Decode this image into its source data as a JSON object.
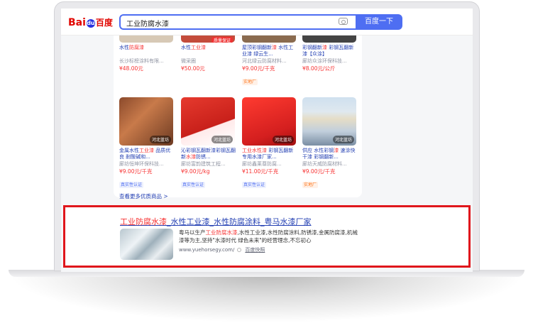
{
  "search": {
    "logo_text_1": "Bai",
    "logo_paw": "du",
    "logo_text_2": "百度",
    "query": "工业防腐水漆",
    "button_label": "百度一下"
  },
  "products": {
    "top_row": [
      {
        "title_a": "水性",
        "title_hl": "防腐漆",
        "title_b": "",
        "shop": "长沙标榜涂料有限...",
        "price": "¥48.00元",
        "badge": "",
        "tag": ""
      },
      {
        "title_a": "水性",
        "title_hl": "工业漆",
        "title_b": "",
        "shop": "微采圈",
        "price": "¥50.00元",
        "badge": "",
        "tag": "质量保证"
      },
      {
        "title_a": "屋顶彩钢翻新",
        "title_hl": "漆",
        "title_b": " 水性工业漆 绿云生...",
        "shop": "河北绿云防腐材料...",
        "price": "¥9.00元/千克",
        "badge": "实地厂",
        "tag": ""
      },
      {
        "title_a": "彩钢翻新",
        "title_hl": "漆",
        "title_b": " 彩钢瓦翻新漆【众涂】",
        "shop": "廊坊众涂环保科技...",
        "price": "¥8.00元/公斤",
        "badge": "",
        "tag": ""
      }
    ],
    "bottom_row": [
      {
        "title_a": "金属水性",
        "title_hl": "工业漆",
        "title_b": " 品质优良 耐酸碱和...",
        "shop": "廊坊恒坤环保科技...",
        "price": "¥9.00元/千克",
        "badge": "真实性认证",
        "tag": "河北蓝坊"
      },
      {
        "title_a": "沁彩钢瓦翻新漆彩钢瓦翻新",
        "title_hl": "水漆",
        "title_b": "防锈...",
        "shop": "廊坊富韵建筑工程...",
        "price": "¥9.00元/kg",
        "badge": "真实性认证",
        "tag": "河北蓝坊"
      },
      {
        "title_a": "",
        "title_hl": "工业水性漆",
        "title_b": " 彩钢瓦翻新专用水漆厂家...",
        "shop": "廊坊鑫莱尊防腐...",
        "price": "¥11.00元/千克",
        "badge": "真实性认证",
        "tag": "河北蓝坊"
      },
      {
        "title_a": "供应 水性彩钢",
        "title_hl": "漆",
        "title_b": " 速涂快干漆 彩钢翻新...",
        "shop": "廊坊天威防腐材料...",
        "price": "¥9.00元/千克",
        "badge": "实地厂",
        "tag": "河北蓝坊"
      }
    ],
    "more_link": "查看更多优质商品 >"
  },
  "result": {
    "title_hl_1": "工业防腐水漆",
    "title_b": "_水性工业漆_水性防腐涂料_粤马水漆厂家",
    "abstract_a": "粤马以生产",
    "abstract_hl": "工业防腐水漆",
    "abstract_b": ",水性工业漆,水性防腐涂料,防锈漆,金属防腐漆,机械漆等为主,坚持\"水漆时代 绿色未来\"的经营理念,不忘初心",
    "url": "www.yuehorsegy.com/",
    "snapshot": "百度快照"
  },
  "colors": {
    "accent": "#4e6ef2",
    "highlight": "#f73131",
    "frame": "#e0161c"
  }
}
